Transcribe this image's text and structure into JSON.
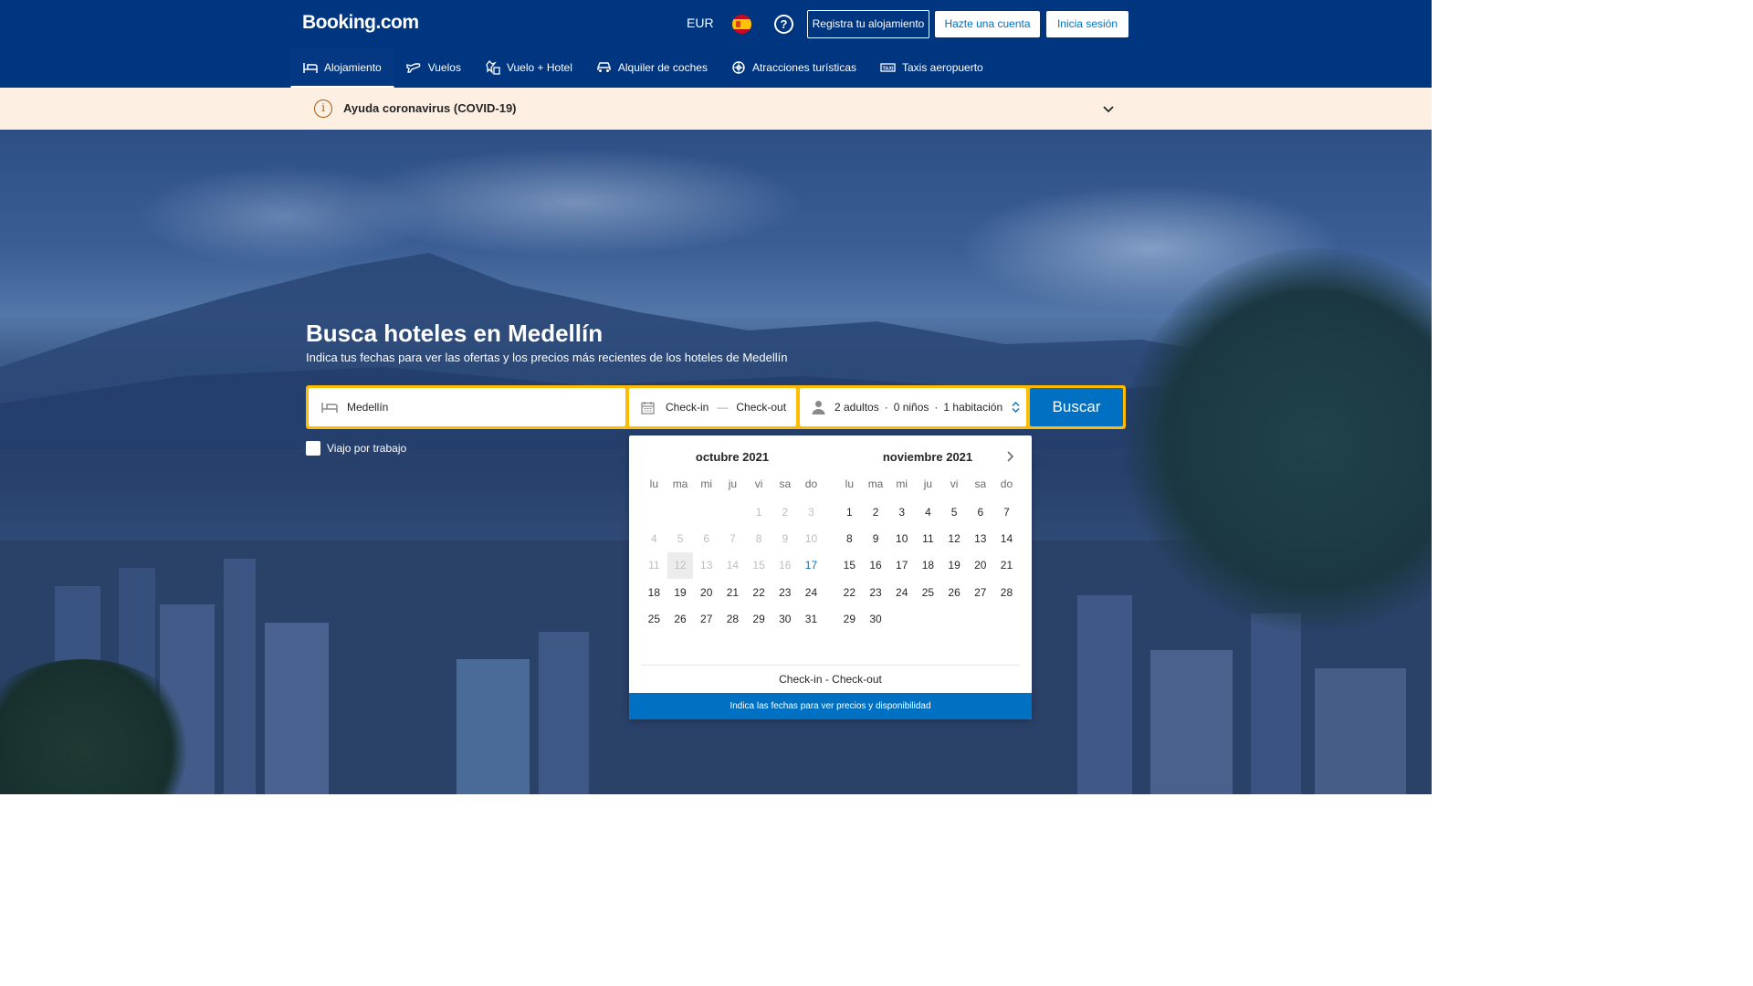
{
  "header": {
    "logo": "Booking.com",
    "currency": "EUR",
    "help_glyph": "?",
    "register_label": "Registra tu alojamiento",
    "create_account_label": "Hazte una cuenta",
    "login_label": "Inicia sesión",
    "flag_icon": "spain-flag-icon"
  },
  "nav": {
    "items": [
      {
        "label": "Alojamiento",
        "icon": "bed-icon",
        "active": true
      },
      {
        "label": "Vuelos",
        "icon": "plane-icon"
      },
      {
        "label": "Vuelo + Hotel",
        "icon": "plane-hotel-icon"
      },
      {
        "label": "Alquiler de coches",
        "icon": "car-icon"
      },
      {
        "label": "Atracciones turísticas",
        "icon": "attractions-icon"
      },
      {
        "label": "Taxis aeropuerto",
        "icon": "taxi-icon"
      }
    ]
  },
  "covid": {
    "icon_glyph": "i",
    "text": "Ayuda coronavirus (COVID-19)"
  },
  "hero": {
    "title": "Busca hoteles en Medellín",
    "subtitle": "Indica tus fechas para ver las ofertas y los precios más recientes de los hoteles de Medellín"
  },
  "search": {
    "destination": "Medellín",
    "checkin": "Check-in",
    "dash": "—",
    "checkout": "Check-out",
    "adults": "2 adultos",
    "sep": "·",
    "children": "0 niños",
    "rooms": "1 habitación",
    "button": "Buscar",
    "work_trip": "Viajo por trabajo"
  },
  "calendar": {
    "weekdays": [
      "lu",
      "ma",
      "mi",
      "ju",
      "vi",
      "sa",
      "do"
    ],
    "months": [
      {
        "title": "octubre 2021",
        "leading_blanks": 4,
        "days": 31,
        "past_until": 16,
        "today": 12,
        "highlight": 17
      },
      {
        "title": "noviembre 2021",
        "leading_blanks": 0,
        "days": 30,
        "past_until": 0,
        "today": 0,
        "highlight": 0
      }
    ],
    "range_label": "Check-in - Check-out",
    "footer": "Indica las fechas para ver precios y disponibilidad"
  },
  "colors": {
    "brand_blue": "#003580",
    "accent_blue": "#0071c2",
    "search_yellow": "#febb02",
    "covid_bg": "#fdf0e2"
  }
}
